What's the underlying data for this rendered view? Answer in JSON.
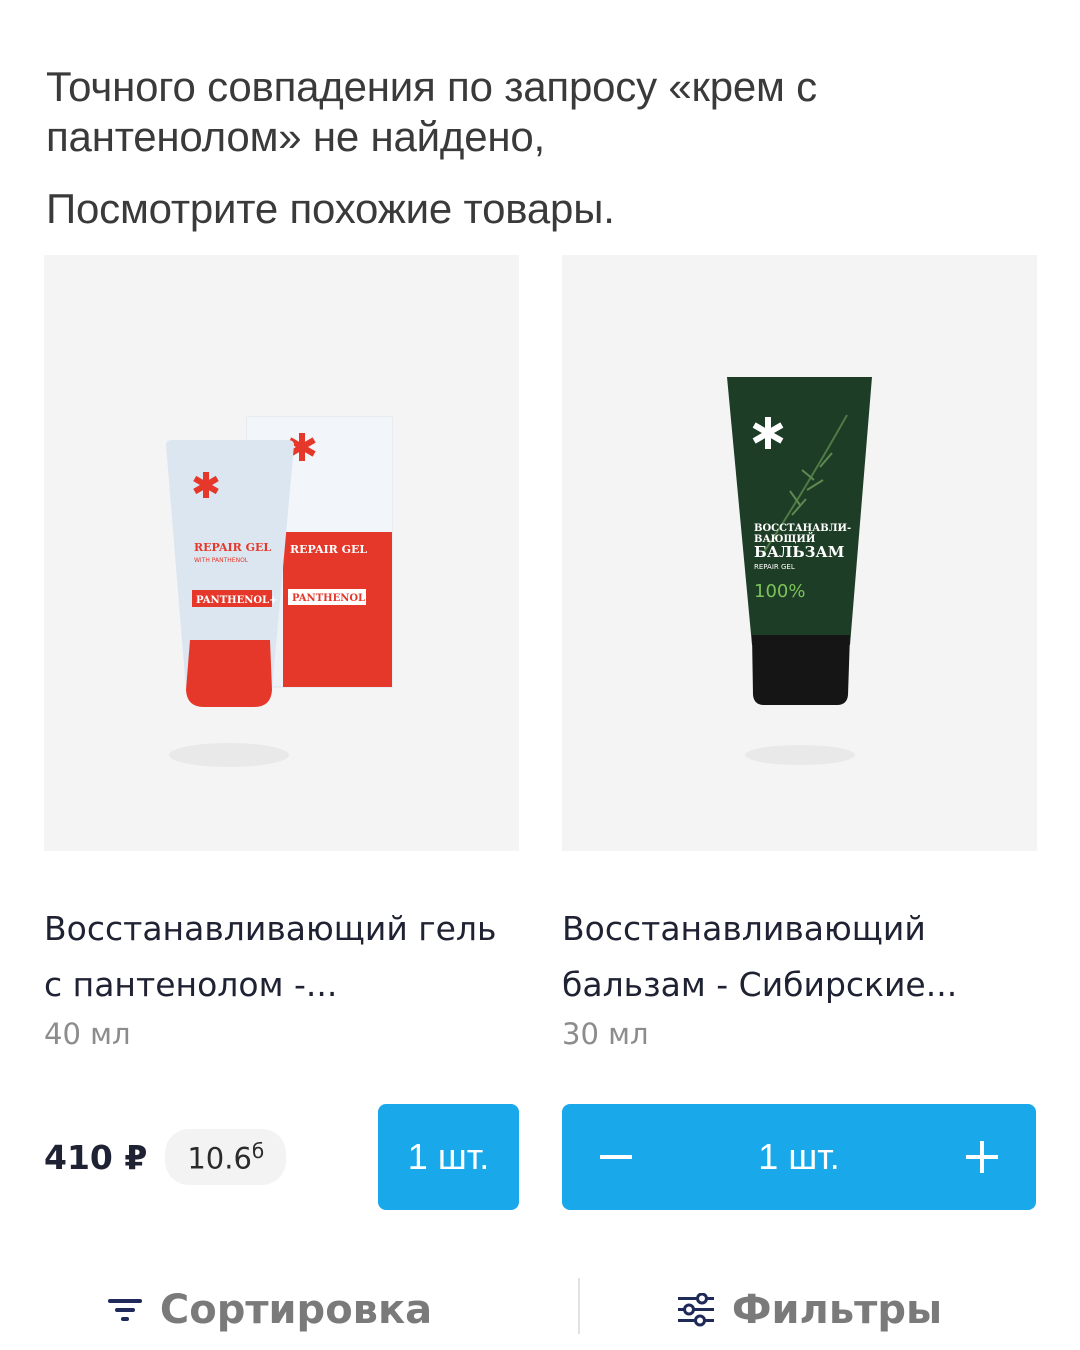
{
  "notice": {
    "line1": "Точного совпадения по запросу «крем с",
    "line2": "пантенолом» не найдено,",
    "line3": "Посмотрите похожие товары."
  },
  "products": [
    {
      "title_line1": "Восстанавливающий гель",
      "title_line2": "с пантенолом -...",
      "volume": "40 мл",
      "price": "410 ₽",
      "points": "10.6",
      "points_suffix": "б",
      "qty_label": "1 шт.",
      "image_text": {
        "tube_line1": "REPAIR GEL",
        "tube_line2": "WITH PANTHENOL",
        "tube_badge": "PANTHENOL+"
      }
    },
    {
      "title_line1": "Восстанавливающий",
      "title_line2": "бальзам - Сибирские...",
      "volume": "30 мл",
      "qty_label": "1 шт.",
      "minus": "−",
      "plus": "+",
      "image_text": {
        "line1": "ВОССТАНАВЛИ-",
        "line2": "ВАЮЩИЙ",
        "line3": "БАЛЬЗАМ",
        "line4": "REPAIR GEL",
        "line5": "100%"
      }
    }
  ],
  "bottom_bar": {
    "sort_label": "Сортировка",
    "filter_label": "Фильтры"
  },
  "colors": {
    "accent": "#19a9ea",
    "image_bg": "#f4f4f5",
    "text": "#1f2233",
    "muted": "#8c8c8c"
  }
}
